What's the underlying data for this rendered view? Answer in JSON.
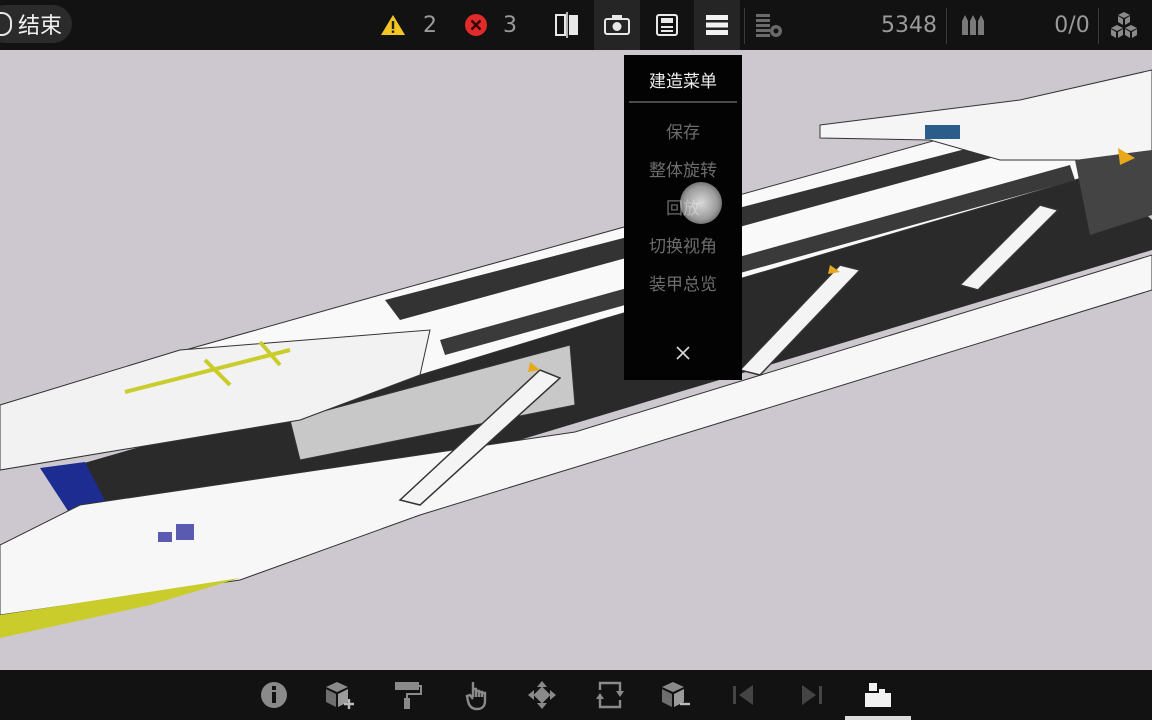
{
  "topbar": {
    "end_label": "结束",
    "warning_count": "2",
    "error_count": "3",
    "points": "5348",
    "ammo": "0/0",
    "icons": [
      "warning-icon",
      "error-icon",
      "mirror-icon",
      "camera-icon",
      "save-icon",
      "menu-icon",
      "stats-icon",
      "ammo-icon",
      "parts-icon"
    ]
  },
  "menu": {
    "title": "建造菜单",
    "items": [
      "保存",
      "整体旋转",
      "回放",
      "切换视角",
      "装甲总览"
    ],
    "close_icon": "close-icon"
  },
  "bottombar": {
    "tools": [
      "info-icon",
      "add-block-icon",
      "paint-roller-icon",
      "touch-icon",
      "move-icon",
      "rotate-icon",
      "remove-block-icon",
      "undo-icon",
      "redo-icon",
      "build-icon"
    ],
    "active_tool": "build-icon"
  },
  "colors": {
    "bar_bg": "#121212",
    "viewport_bg": "#cdc8cf",
    "warning": "#f3c623",
    "error": "#e02b2b",
    "ship_accent": "#c9cc2a",
    "ship_armor_blue": "#1d2c91"
  }
}
